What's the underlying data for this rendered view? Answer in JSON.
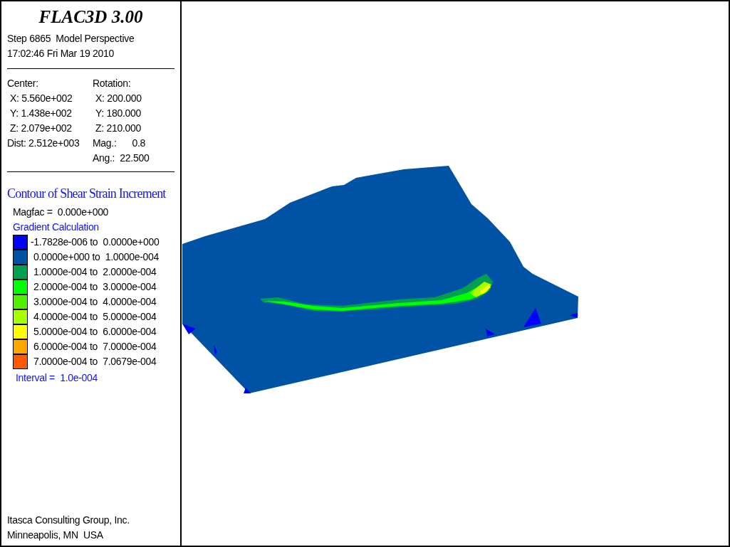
{
  "header": {
    "title": "FLAC3D 3.00",
    "step_line": "Step 6865  Model Perspective",
    "timestamp": "17:02:46 Fri Mar 19 2010"
  },
  "view": {
    "center_heading": "Center:",
    "rotation_heading": "Rotation:",
    "center": [
      "X: 5.560e+002",
      "Y: 1.438e+002",
      "Z: 2.079e+002"
    ],
    "dist": "Dist: 2.512e+003",
    "rotation": [
      "X: 200.000",
      "Y: 180.000",
      "Z: 210.000"
    ],
    "mag": {
      "label": "Mag.:",
      "value": "0.8"
    },
    "ang": "Ang.:  22.500"
  },
  "legend": {
    "title": "Contour of Shear Strain Increment",
    "magfac": "Magfac =  0.000e+000",
    "method": "Gradient Calculation",
    "items": [
      {
        "label": "-1.7828e-006 to  0.0000e+000",
        "color": "#0000ff"
      },
      {
        "label": "0.0000e+000 to  1.0000e-004",
        "color": "#0052a5"
      },
      {
        "label": "1.0000e-004 to  2.0000e-004",
        "color": "#00a050"
      },
      {
        "label": "2.0000e-004 to  3.0000e-004",
        "color": "#00ff00"
      },
      {
        "label": "3.0000e-004 to  4.0000e-004",
        "color": "#50f000"
      },
      {
        "label": "4.0000e-004 to  5.0000e-004",
        "color": "#a8ff00"
      },
      {
        "label": "5.0000e-004 to  6.0000e-004",
        "color": "#ffff00"
      },
      {
        "label": "6.0000e-004 to  7.0000e-004",
        "color": "#ffa500"
      },
      {
        "label": "7.0000e-004 to  7.0679e-004",
        "color": "#ff5a00"
      }
    ],
    "interval": "Interval =  1.0e-004"
  },
  "footer": {
    "company": "Itasca Consulting Group, Inc.",
    "location": "Minneapolis, MN  USA"
  }
}
